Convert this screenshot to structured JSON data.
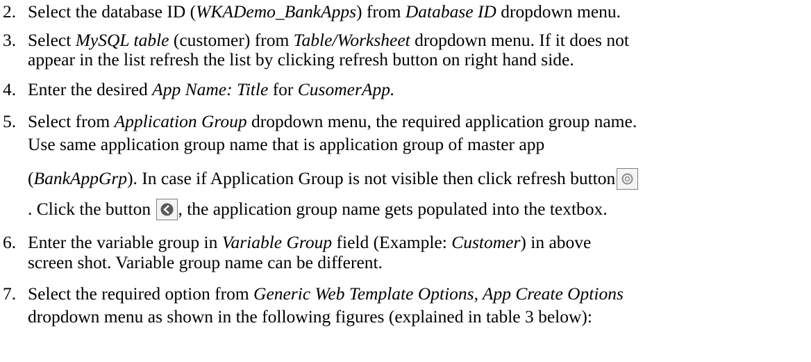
{
  "steps": [
    {
      "number": "2.",
      "lines": [
        [
          {
            "t": "Select the database ID ("
          },
          {
            "t": "WKADemo_BankApps",
            "i": true
          },
          {
            "t": ") from "
          },
          {
            "t": "Database ID",
            "i": true
          },
          {
            "t": " dropdown menu."
          }
        ]
      ]
    },
    {
      "number": "3.",
      "lines": [
        [
          {
            "t": "Select "
          },
          {
            "t": "MySQL table",
            "i": true
          },
          {
            "t": " (customer) from "
          },
          {
            "t": "Table/Worksheet",
            "i": true
          },
          {
            "t": " dropdown menu. If it does not"
          }
        ],
        [
          {
            "t": "appear in the list refresh the list by clicking refresh button on right hand side."
          }
        ]
      ]
    },
    {
      "number": "4.",
      "lines": [
        [
          {
            "t": "Enter the desired "
          },
          {
            "t": "App Name: Title",
            "i": true
          },
          {
            "t": " for "
          },
          {
            "t": "CusomerApp.",
            "i": true
          }
        ]
      ]
    },
    {
      "number": "5.",
      "lines": [
        [
          {
            "t": "Select from "
          },
          {
            "t": "Application Group",
            "i": true
          },
          {
            "t": " dropdown menu, the required application group name."
          }
        ],
        [
          {
            "t": "Use same application group name that is application group of master app"
          }
        ],
        [
          {
            "t": "("
          },
          {
            "t": "BankAppGrp",
            "i": true
          },
          {
            "t": "). In case if Application Group is not visible then click refresh button"
          },
          {
            "icon": "refresh-icon"
          }
        ],
        [
          {
            "t": ". Click the button "
          },
          {
            "icon": "select-arrow-icon"
          },
          {
            "t": ", the application group name gets populated into the textbox."
          }
        ]
      ]
    },
    {
      "number": "6.",
      "lines": [
        [
          {
            "t": "Enter the variable group in "
          },
          {
            "t": "Variable Group",
            "i": true
          },
          {
            "t": " field (Example: "
          },
          {
            "t": "Customer",
            "i": true
          },
          {
            "t": ") in above"
          }
        ],
        [
          {
            "t": "screen shot. Variable group name can be different."
          }
        ]
      ]
    },
    {
      "number": "7.",
      "lines": [
        [
          {
            "t": "Select the required option from "
          },
          {
            "t": "Generic Web Template Options, App Create Options",
            "i": true
          }
        ],
        [
          {
            "t": "dropdown menu as shown in the following figures (explained in table 3 below):"
          }
        ]
      ]
    }
  ],
  "icons": {
    "refresh_color": "#8a8a8a",
    "select_color": "#5a5a5a"
  }
}
